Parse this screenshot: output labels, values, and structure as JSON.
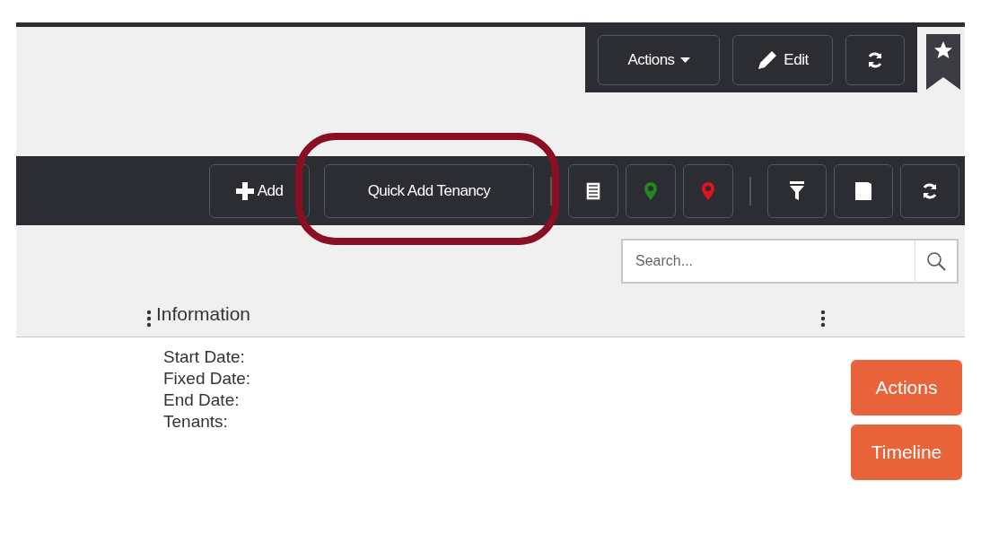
{
  "header_toolbar": {
    "buttons": [
      {
        "kind": "dropdown",
        "label": "Actions"
      },
      {
        "kind": "edit",
        "label": "Edit"
      },
      {
        "kind": "refresh"
      }
    ]
  },
  "list_toolbar": {
    "items": [
      {
        "kind": "add",
        "label": "Add"
      },
      {
        "kind": "text",
        "label": "Quick Add Tenancy",
        "highlighted": true
      },
      {
        "kind": "separator"
      },
      {
        "kind": "list"
      },
      {
        "kind": "pin",
        "color": "#1e8a1e"
      },
      {
        "kind": "pin",
        "color": "#e0141e"
      },
      {
        "kind": "separator"
      },
      {
        "kind": "filter"
      },
      {
        "kind": "book"
      },
      {
        "kind": "refresh"
      }
    ]
  },
  "search": {
    "placeholder": "Search..."
  },
  "table": {
    "columns": [
      "Information"
    ]
  },
  "info_labels": [
    "Start Date:",
    "Fixed Date:",
    "End Date:",
    "Tenants:"
  ],
  "row_buttons": [
    "Actions",
    "Timeline"
  ]
}
